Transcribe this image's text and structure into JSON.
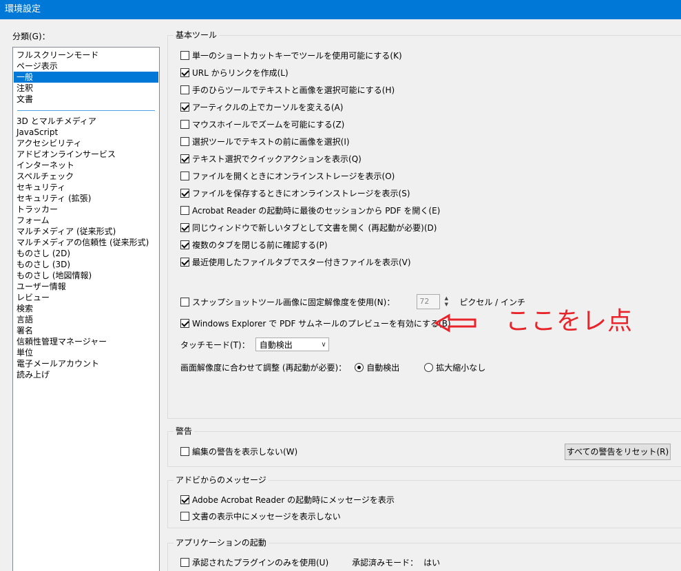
{
  "window": {
    "title": "環境設定"
  },
  "categories": {
    "label": "分類(G)：",
    "top_items": [
      "フルスクリーンモード",
      "ページ表示",
      "一般",
      "注釈",
      "文書"
    ],
    "selected": "一般",
    "items": [
      "3D とマルチメディア",
      "JavaScript",
      "アクセシビリティ",
      "アドビオンラインサービス",
      "インターネット",
      "スペルチェック",
      "セキュリティ",
      "セキュリティ (拡張)",
      "トラッカー",
      "フォーム",
      "マルチメディア (従来形式)",
      "マルチメディアの信頼性 (従来形式)",
      "ものさし (2D)",
      "ものさし (3D)",
      "ものさし (地図情報)",
      "ユーザー情報",
      "レビュー",
      "検索",
      "言語",
      "署名",
      "信頼性管理マネージャー",
      "単位",
      "電子メールアカウント",
      "読み上げ"
    ]
  },
  "basic_tools": {
    "title": "基本ツール",
    "options": [
      {
        "label": "単一のショートカットキーでツールを使用可能にする(K)",
        "checked": false
      },
      {
        "label": "URL からリンクを作成(L)",
        "checked": true
      },
      {
        "label": "手のひらツールでテキストと画像を選択可能にする(H)",
        "checked": false
      },
      {
        "label": "アーティクルの上でカーソルを変える(A)",
        "checked": true
      },
      {
        "label": "マウスホイールでズームを可能にする(Z)",
        "checked": false
      },
      {
        "label": "選択ツールでテキストの前に画像を選択(I)",
        "checked": false
      },
      {
        "label": "テキスト選択でクイックアクションを表示(Q)",
        "checked": true
      },
      {
        "label": "ファイルを開くときにオンラインストレージを表示(O)",
        "checked": false
      },
      {
        "label": "ファイルを保存するときにオンラインストレージを表示(S)",
        "checked": true
      },
      {
        "label": "Acrobat Reader の起動時に最後のセッションから PDF を開く(E)",
        "checked": false
      },
      {
        "label": "同じウィンドウで新しいタブとして文書を開く (再起動が必要)(D)",
        "checked": true
      },
      {
        "label": "複数のタブを閉じる前に確認する(P)",
        "checked": true
      },
      {
        "label": "最近使用したファイルタブでスター付きファイルを表示(V)",
        "checked": true
      }
    ],
    "snapshot": {
      "label": "スナップショットツール画像に固定解像度を使用(N)：",
      "checked": false,
      "value": "72",
      "unit": "ピクセル / インチ"
    },
    "explorer_preview": {
      "label": "Windows Explorer で PDF サムネールのプレビューを有効にする(B)",
      "checked": true
    },
    "touch_mode": {
      "label": "タッチモード(T)：",
      "value": "自動検出"
    },
    "resolution": {
      "label": "画面解像度に合わせて調整 (再起動が必要)：",
      "options": [
        {
          "label": "自動検出",
          "checked": true
        },
        {
          "label": "拡大縮小なし",
          "checked": false
        }
      ]
    }
  },
  "warnings": {
    "title": "警告",
    "option": {
      "label": "編集の警告を表示しない(W)",
      "checked": false
    },
    "reset_button": "すべての警告をリセット(R)"
  },
  "adobe_messages": {
    "title": "アドビからのメッセージ",
    "options": [
      {
        "label": "Adobe Acrobat Reader の起動時にメッセージを表示",
        "checked": true
      },
      {
        "label": "文書の表示中にメッセージを表示しない",
        "checked": false
      }
    ]
  },
  "app_startup": {
    "title": "アプリケーションの起動",
    "option": {
      "label": "承認されたプラグインのみを使用(U)",
      "checked": false
    },
    "approved_mode_label": "承認済みモード：",
    "approved_mode_value": "はい"
  },
  "annotation": {
    "text": "ここをレ点",
    "color": "#e8242a"
  },
  "colors": {
    "accent": "#0078d7",
    "annotation": "#e8242a"
  }
}
